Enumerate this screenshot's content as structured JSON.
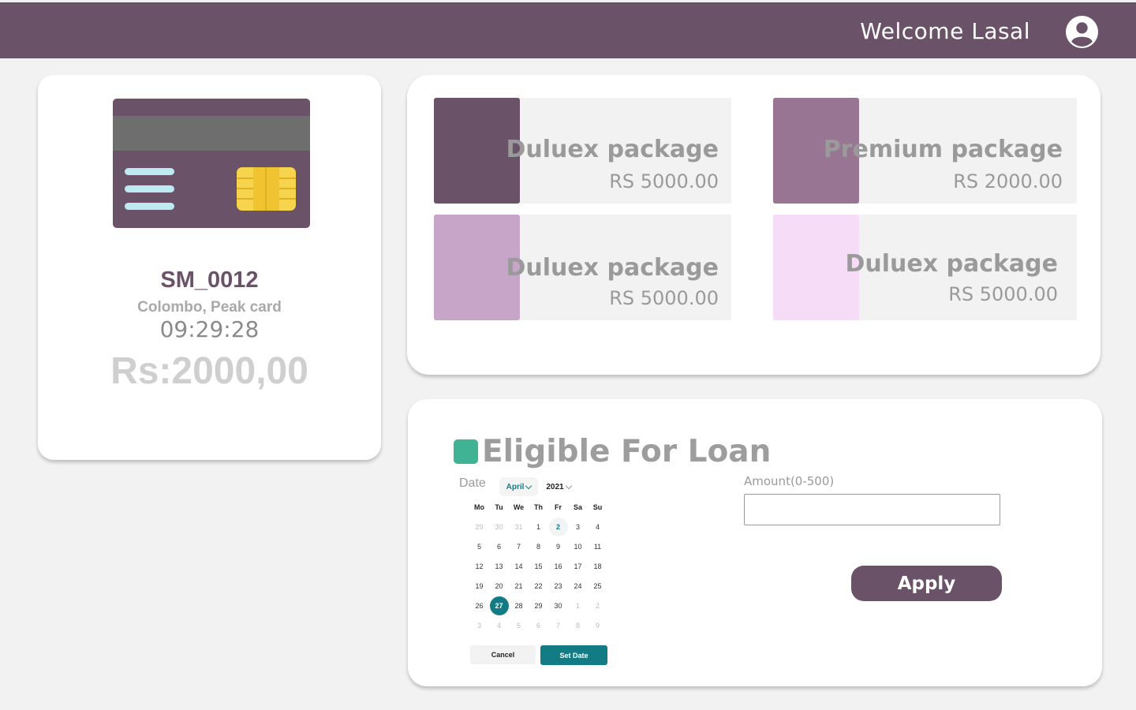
{
  "header": {
    "welcome_text": "Welcome Lasal",
    "avatar_icon": "user-circle-icon",
    "background": "#6a5268"
  },
  "card": {
    "id": "SM_0012",
    "location": "Colombo, Peak card",
    "time": "09:29:28",
    "amount": "Rs:2000,00",
    "icon": "credit-card-icon"
  },
  "packages": [
    {
      "name": "Duluex package",
      "price": "RS 5000.00",
      "color": "#6a5268"
    },
    {
      "name": "Premium package",
      "price": "RS 2000.00",
      "color": "#977593"
    },
    {
      "name": "Duluex package",
      "price": "RS 5000.00",
      "color": "#c6a5c8"
    },
    {
      "name": "Duluex package",
      "price": "RS 5000.00",
      "color": "#f7dcf7"
    }
  ],
  "loan": {
    "title": "Eligible For Loan",
    "accent": "#3fb393",
    "date_label": "Date",
    "month": "April",
    "year": "2021",
    "weekdays": [
      "Mo",
      "Tu",
      "We",
      "Th",
      "Fr",
      "Sa",
      "Su"
    ],
    "weeks": [
      [
        "29",
        "30",
        "31",
        "1",
        "2",
        "3",
        "4"
      ],
      [
        "5",
        "6",
        "7",
        "8",
        "9",
        "10",
        "11"
      ],
      [
        "12",
        "13",
        "14",
        "15",
        "16",
        "17",
        "18"
      ],
      [
        "19",
        "20",
        "21",
        "22",
        "23",
        "24",
        "25"
      ],
      [
        "26",
        "27",
        "28",
        "29",
        "30",
        "1",
        "2"
      ],
      [
        "3",
        "4",
        "5",
        "6",
        "7",
        "8",
        "9"
      ]
    ],
    "today": "2",
    "selected": "27",
    "cancel_label": "Cancel",
    "set_date_label": "Set Date",
    "amount_label": "Amount(0-500)",
    "amount_value": "",
    "apply_label": "Apply",
    "calendar_accent": "#127b84"
  }
}
